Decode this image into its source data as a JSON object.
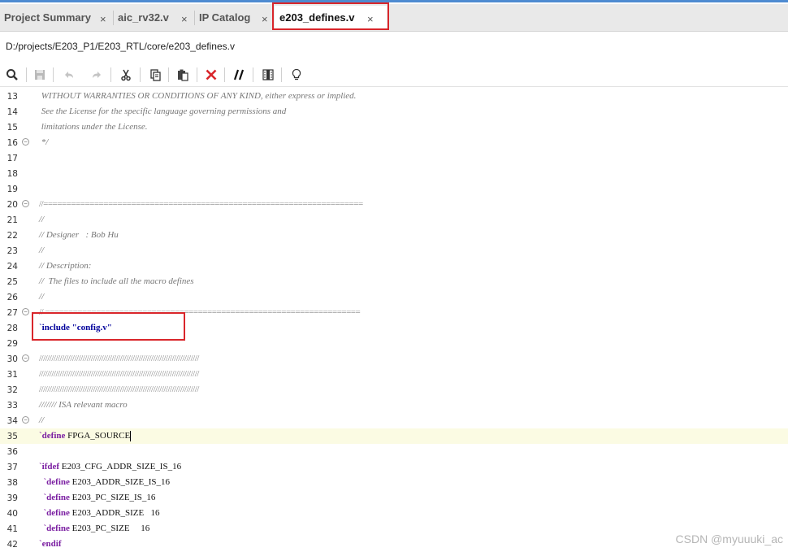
{
  "tabs": [
    {
      "label": "Project Summary",
      "close": "×"
    },
    {
      "label": "aic_rv32.v",
      "close": "×"
    },
    {
      "label": "IP Catalog",
      "close": "×"
    },
    {
      "label": "e203_defines.v",
      "close": "×",
      "active": true
    }
  ],
  "file_path": "D:/projects/E203_P1/E203_RTL/core/e203_defines.v",
  "toolbar": {
    "icons": [
      "search-icon",
      "save-icon",
      "undo-icon",
      "redo-icon",
      "cut-icon",
      "copy-icon",
      "paste-icon",
      "delete-icon",
      "comment-icon",
      "column-select-icon",
      "quick-help-icon"
    ]
  },
  "editor": {
    "current_line": 35,
    "lines": [
      {
        "n": "13",
        "text": " WITHOUT WARRANTIES OR CONDITIONS OF ANY KIND, either express or implied."
      },
      {
        "n": "14",
        "text": " See the License for the specific language governing permissions and"
      },
      {
        "n": "15",
        "text": " limitations under the License."
      },
      {
        "n": "16",
        "text": " */"
      },
      {
        "n": "17",
        "text": ""
      },
      {
        "n": "18",
        "text": ""
      },
      {
        "n": "19",
        "text": ""
      },
      {
        "n": "20",
        "text": "//====================================================================="
      },
      {
        "n": "21",
        "text": "//"
      },
      {
        "n": "22",
        "text": "// Designer   : Bob Hu"
      },
      {
        "n": "23",
        "text": "//"
      },
      {
        "n": "24",
        "text": "// Description:"
      },
      {
        "n": "25",
        "text": "//  The files to include all the macro defines"
      },
      {
        "n": "26",
        "text": "//"
      },
      {
        "n": "27",
        "text": "// ===================================================================="
      },
      {
        "n": "28",
        "kw": "`include",
        "str": " \"config.v\""
      },
      {
        "n": "29",
        "text": ""
      },
      {
        "n": "30",
        "text": "/////////////////////////////////////////////////////////////////////////////"
      },
      {
        "n": "31",
        "text": "/////////////////////////////////////////////////////////////////////////////"
      },
      {
        "n": "32",
        "text": "/////////////////////////////////////////////////////////////////////////////"
      },
      {
        "n": "33",
        "text": "/////// ISA relevant macro"
      },
      {
        "n": "34",
        "text": "//"
      },
      {
        "n": "35",
        "kw": "`define",
        "rest": " FPGA_SOURCE"
      },
      {
        "n": "36",
        "text": ""
      },
      {
        "n": "37",
        "kw": "`ifdef",
        "rest": " E203_CFG_ADDR_SIZE_IS_16"
      },
      {
        "n": "38",
        "kw": "  `define",
        "rest": " E203_ADDR_SIZE_IS_16"
      },
      {
        "n": "39",
        "kw": "  `define",
        "rest": " E203_PC_SIZE_IS_16"
      },
      {
        "n": "40",
        "kw": "  `define",
        "rest": " E203_ADDR_SIZE   16"
      },
      {
        "n": "41",
        "kw": "  `define",
        "rest": " E203_PC_SIZE     16"
      },
      {
        "n": "42",
        "kw": "`endif",
        "rest": ""
      }
    ]
  },
  "watermark": "CSDN @myuuuki_ac",
  "colors": {
    "highlight_box": "#d9262b",
    "current_line": "#fbfbe3",
    "keyword": "#7b1fa2",
    "string": "#00009b"
  }
}
